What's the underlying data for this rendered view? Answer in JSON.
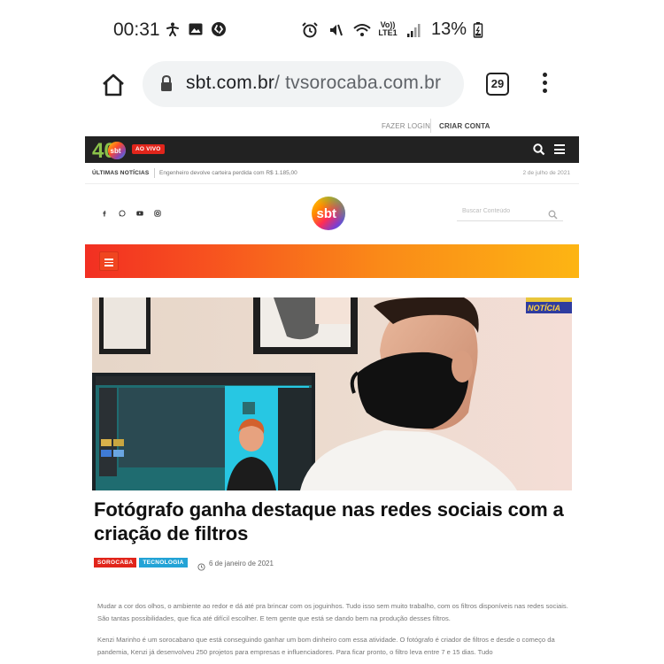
{
  "status_bar": {
    "time": "00:31",
    "left_icons": [
      "accessibility-icon",
      "image-icon",
      "shazam-icon"
    ],
    "right_icons": [
      "alarm-icon",
      "mute-icon",
      "wifi-icon",
      "volte-icon",
      "signal-icon"
    ],
    "volte_top": "Vo))",
    "volte_bottom": "LTE1",
    "battery": "13%"
  },
  "browser": {
    "url_host": "sbt.com.br",
    "url_path": "/ tvsorocaba.com.br",
    "tab_count": "29"
  },
  "site": {
    "top_links": {
      "login": "FAZER LOGIN",
      "create_account": "CRIAR CONTA"
    },
    "live_badge": "AO VIVO",
    "logo_number": "40",
    "logo_text": "sbt",
    "ticker": {
      "label": "ÚLTIMAS NOTÍCIAS",
      "text": "Engenheiro devolve carteira perdida com R$ 1.185,00",
      "date": "2 de julho de 2021"
    },
    "social_icons": [
      "facebook-icon",
      "whatsapp-icon",
      "youtube-icon",
      "instagram-icon"
    ],
    "search_placeholder": "Buscar Conteúdo",
    "hero_overlay": "NOTÍCIA",
    "headline": "Fotógrafo ganha destaque nas redes sociais com a criação de filtros",
    "tags": [
      "SOROCABA",
      "TECNOLOGIA"
    ],
    "date": "6 de janeiro de 2021",
    "paragraphs": [
      "Mudar a cor dos olhos, o ambiente ao redor e dá até pra brincar com os joguinhos. Tudo isso sem muito trabalho, com os filtros disponíveis nas redes sociais. São tantas possibilidades, que fica até difícil escolher. E tem gente que está se dando bem na produção desses filtros.",
      "Kenzi Marinho é um sorocabano que está conseguindo ganhar um bom dinheiro com essa atividade. O fotógrafo é criador de filtros e desde o começo da pandemia, Kenzi já desenvolveu 250 projetos para empresas e influenciadores. Para ficar pronto, o filtro leva entre 7 e 15 dias. Tudo"
    ]
  },
  "colors": {
    "brand_red": "#e1251b",
    "tag_blue": "#23a3d6",
    "gradient_start": "#f22f22",
    "gradient_end": "#fdb513",
    "header_black": "#222222"
  }
}
